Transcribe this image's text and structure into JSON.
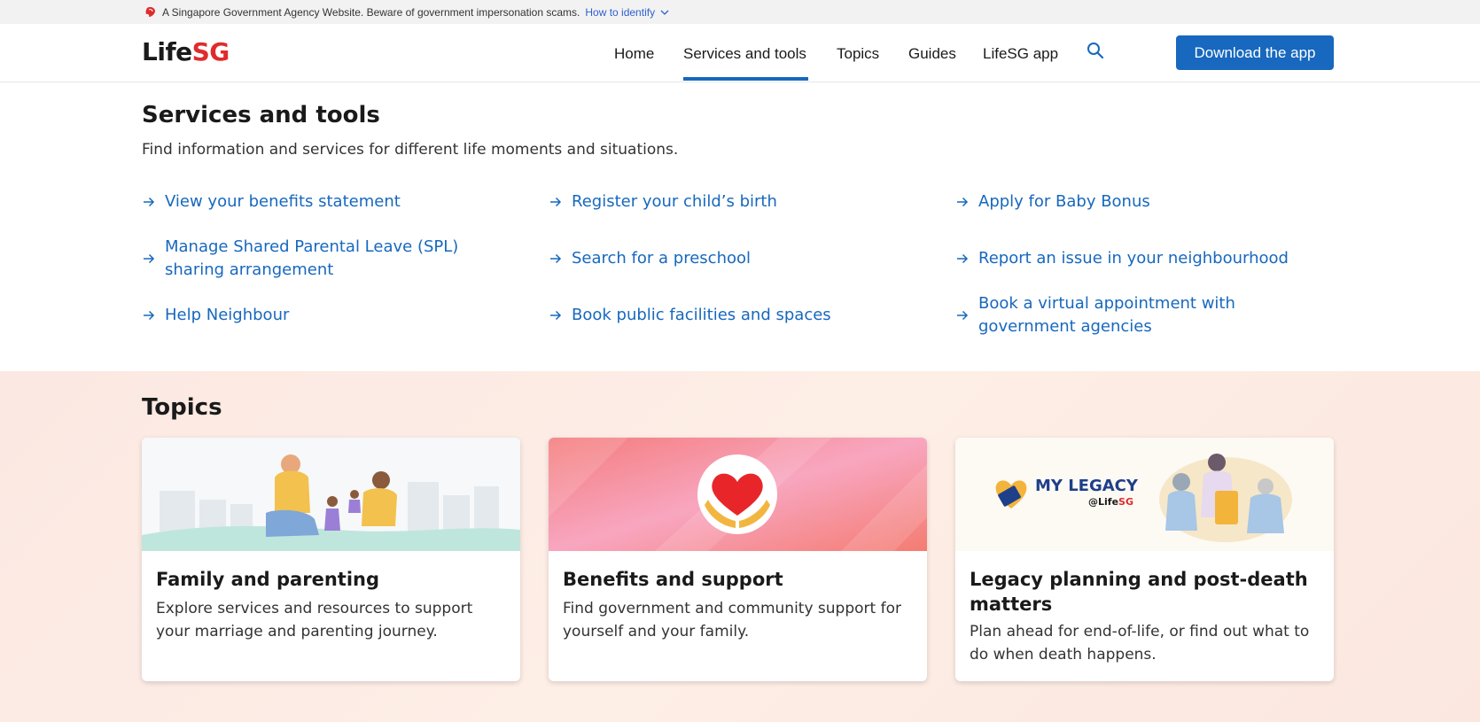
{
  "masthead": {
    "notice": "A Singapore Government Agency Website. Beware of government impersonation scams.",
    "link_label": "How to identify"
  },
  "header": {
    "logo_life": "Life",
    "logo_sg": "SG",
    "nav": [
      {
        "label": "Home"
      },
      {
        "label": "Services and tools",
        "active": true
      },
      {
        "label": "Topics"
      },
      {
        "label": "Guides"
      },
      {
        "label": "LifeSG app"
      }
    ],
    "download_label": "Download the app"
  },
  "services": {
    "title": "Services and tools",
    "subtitle": "Find information and services for different life moments and situations.",
    "links": [
      {
        "label": "View your benefits statement"
      },
      {
        "label": "Register your child’s birth"
      },
      {
        "label": "Apply for Baby Bonus"
      },
      {
        "label": "Manage Shared Parental Leave (SPL) sharing arrangement"
      },
      {
        "label": "Search for a preschool"
      },
      {
        "label": "Report an issue in your neighbourhood"
      },
      {
        "label": "Help Neighbour"
      },
      {
        "label": "Book public facilities and spaces"
      },
      {
        "label": "Book a virtual appointment with government agencies"
      }
    ]
  },
  "topics": {
    "title": "Topics",
    "cards": [
      {
        "title": "Family and parenting",
        "description": "Explore services and resources to support your marriage and parenting journey."
      },
      {
        "title": "Benefits and support",
        "description": "Find government and community support for yourself and your family."
      },
      {
        "title": "Legacy planning and post-death matters",
        "description": "Plan ahead for end-of-life, or find out what to do when death happens.",
        "logo_text": "MY LEGACY",
        "logo_sub_at": "@Life",
        "logo_sub_sg": "SG"
      }
    ]
  },
  "colors": {
    "brand_blue": "#1768be",
    "brand_red": "#e02b2b",
    "topics_bg": "#fbe8e2"
  },
  "icons": [
    "lion-head-icon",
    "chevron-down-icon",
    "search-icon",
    "arrow-right-icon",
    "heart-hands-icon",
    "legacy-heart-icon"
  ]
}
